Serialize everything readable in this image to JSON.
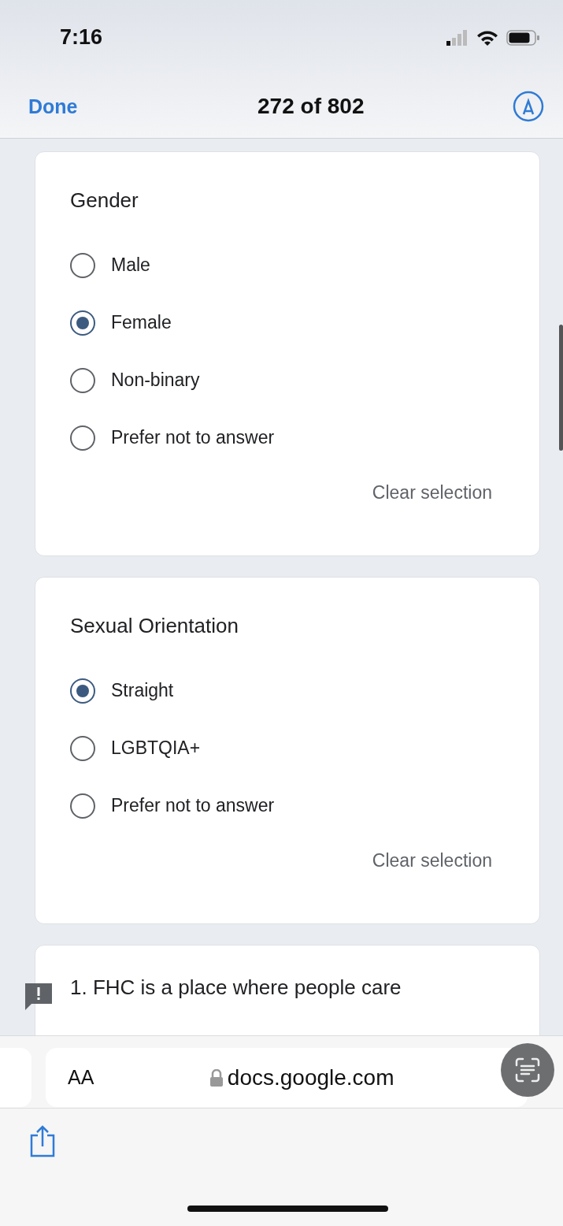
{
  "status_bar": {
    "time": "7:16"
  },
  "nav_bar": {
    "done": "Done",
    "title": "272 of 802"
  },
  "questions": [
    {
      "title": "Gender",
      "clear": "Clear selection",
      "options": [
        {
          "label": "Male",
          "selected": false
        },
        {
          "label": "Female",
          "selected": true
        },
        {
          "label": "Non-binary",
          "selected": false
        },
        {
          "label": "Prefer not to answer",
          "selected": false
        }
      ]
    },
    {
      "title": "Sexual Orientation",
      "clear": "Clear selection",
      "options": [
        {
          "label": "Straight",
          "selected": true
        },
        {
          "label": "LGBTQIA+",
          "selected": false
        },
        {
          "label": "Prefer not to answer",
          "selected": false
        }
      ]
    }
  ],
  "next_question": {
    "text": "1. FHC is a place where people care"
  },
  "address_bar": {
    "text_size": "AA",
    "url": "docs.google.com"
  }
}
